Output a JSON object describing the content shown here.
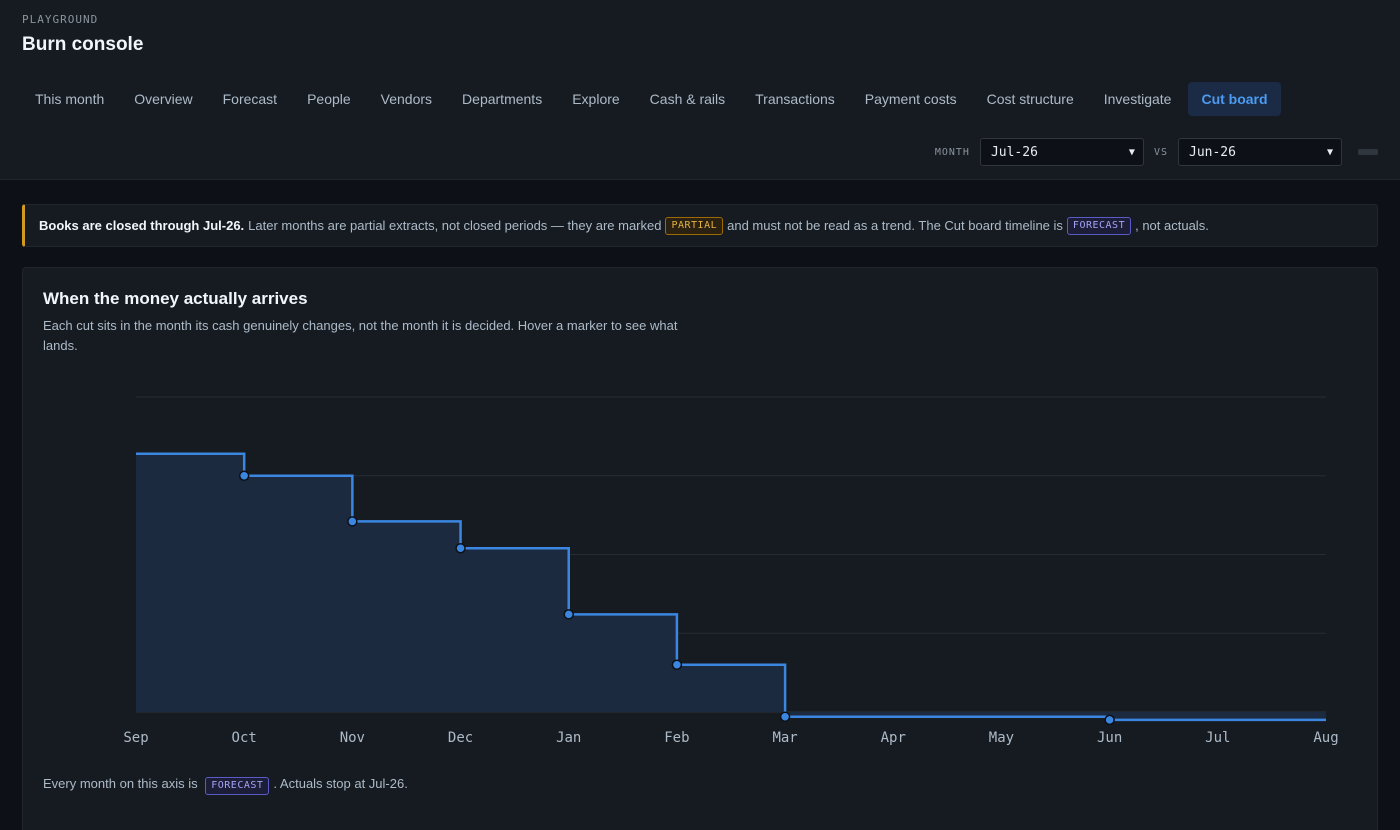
{
  "header": {
    "eyebrow": "PLAYGROUND",
    "title": "Burn console"
  },
  "tabs": [
    {
      "label": "This month",
      "active": false
    },
    {
      "label": "Overview",
      "active": false
    },
    {
      "label": "Forecast",
      "active": false
    },
    {
      "label": "People",
      "active": false
    },
    {
      "label": "Vendors",
      "active": false
    },
    {
      "label": "Departments",
      "active": false
    },
    {
      "label": "Explore",
      "active": false
    },
    {
      "label": "Cash & rails",
      "active": false
    },
    {
      "label": "Transactions",
      "active": false
    },
    {
      "label": "Payment costs",
      "active": false
    },
    {
      "label": "Cost structure",
      "active": false
    },
    {
      "label": "Investigate",
      "active": false
    },
    {
      "label": "Cut board",
      "active": true
    }
  ],
  "controls": {
    "month_label": "MONTH",
    "month_value": "Jul-26",
    "vs_label": "VS",
    "vs_value": "Jun-26"
  },
  "notice": {
    "bold": "Books are closed through Jul-26.",
    "text1": "Later months are partial extracts, not closed periods — they are marked",
    "partial_tag": "PARTIAL",
    "text2": "and must not be read as a trend. The Cut board timeline is",
    "forecast_tag": "FORECAST",
    "text3": ", not actuals."
  },
  "card": {
    "title": "When the money actually arrives",
    "description": "Each cut sits in the month its cash genuinely changes, not the month it is decided. Hover a marker to see what lands.",
    "footer_text1": "Every month on this axis is",
    "footer_tag": "FORECAST",
    "footer_text2": ". Actuals stop at Jul-26."
  },
  "colors": {
    "accent": "#3a86e0",
    "area_fill": "#1b2a3e",
    "warning": "#d29922",
    "forecast": "#a5a3f5"
  },
  "chart_data": {
    "type": "area",
    "step": true,
    "x": [
      "Sep",
      "Oct",
      "Nov",
      "Dec",
      "Jan",
      "Feb",
      "Mar",
      "Apr",
      "May",
      "Jun",
      "Jul",
      "Aug"
    ],
    "values": [
      82,
      75,
      60.5,
      52,
      31,
      15,
      -1.5,
      -1.5,
      -1.5,
      -2.5,
      -2.5,
      -2.5
    ],
    "markers": [
      "Oct",
      "Nov",
      "Dec",
      "Jan",
      "Feb",
      "Mar",
      "Jun"
    ],
    "ylim": [
      0,
      100
    ],
    "grid": true,
    "title": "",
    "xlabel": "",
    "ylabel": ""
  }
}
